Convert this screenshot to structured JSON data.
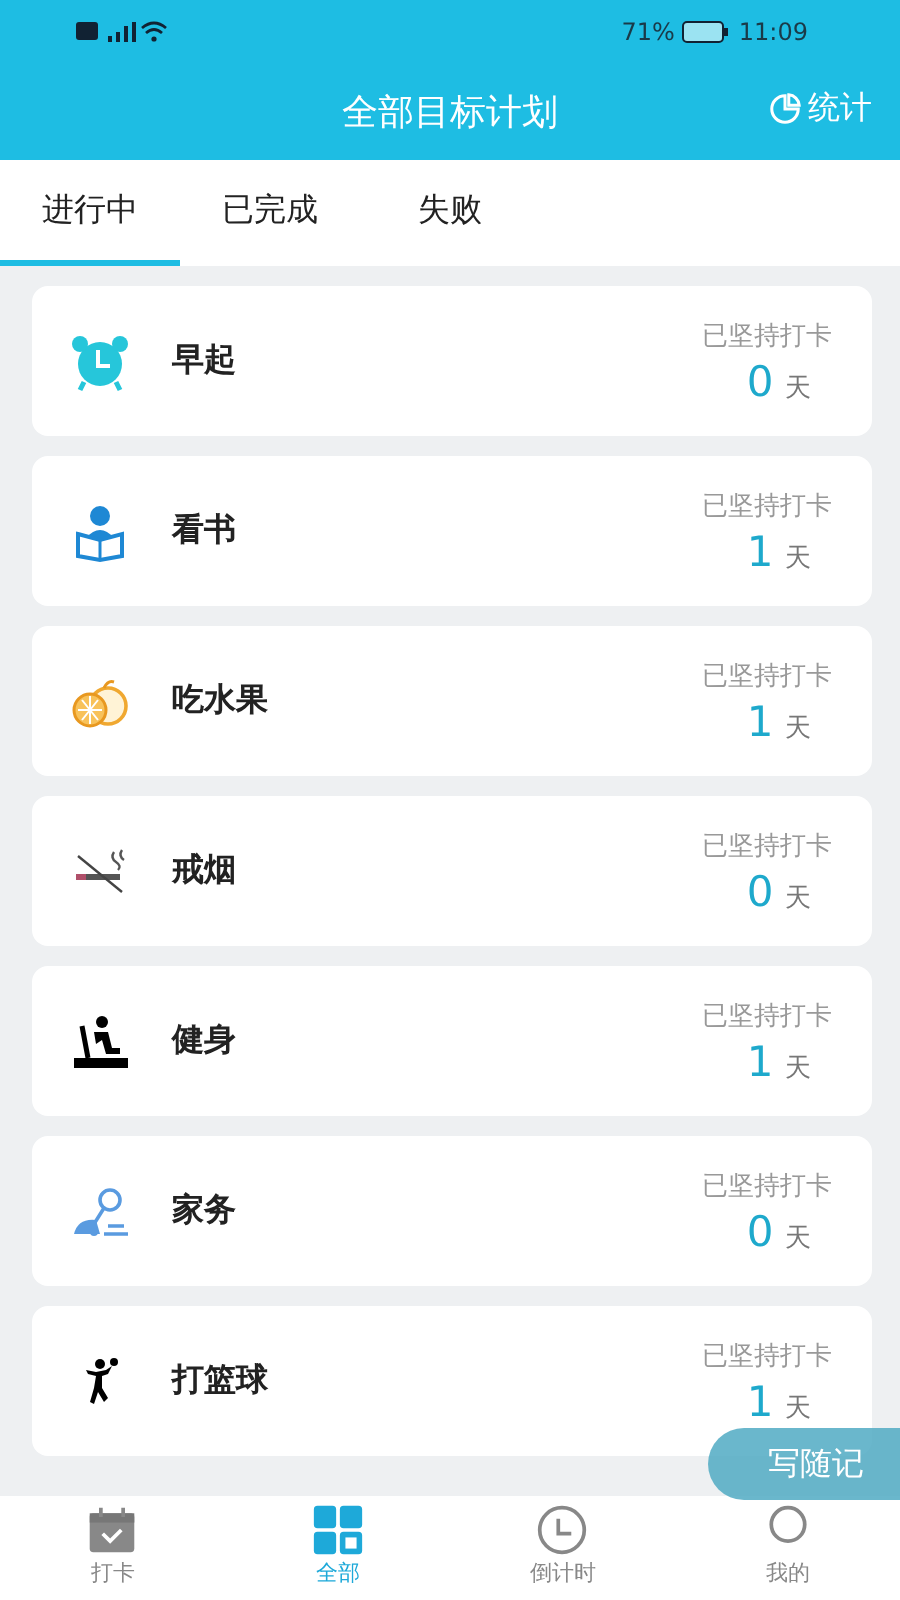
{
  "status_bar": {
    "battery": "71%",
    "time": "11:09"
  },
  "header": {
    "title": "全部目标计划",
    "action": "统计"
  },
  "tabs": [
    {
      "label": "进行中",
      "selected": true
    },
    {
      "label": "已完成",
      "selected": false
    },
    {
      "label": "失败",
      "selected": false
    }
  ],
  "goals": [
    {
      "kind": "alarm",
      "name": "早起",
      "caption": "已坚持打卡",
      "days": "0",
      "unit": "天"
    },
    {
      "kind": "reading",
      "name": "看书",
      "caption": "已坚持打卡",
      "days": "1",
      "unit": "天"
    },
    {
      "kind": "fruit",
      "name": "吃水果",
      "caption": "已坚持打卡",
      "days": "1",
      "unit": "天"
    },
    {
      "kind": "smoking",
      "name": "戒烟",
      "caption": "已坚持打卡",
      "days": "0",
      "unit": "天"
    },
    {
      "kind": "fitness",
      "name": "健身",
      "caption": "已坚持打卡",
      "days": "1",
      "unit": "天"
    },
    {
      "kind": "chores",
      "name": "家务",
      "caption": "已坚持打卡",
      "days": "0",
      "unit": "天"
    },
    {
      "kind": "basketball",
      "name": "打篮球",
      "caption": "已坚持打卡",
      "days": "1",
      "unit": "天"
    }
  ],
  "float_button": "写随记",
  "bottom_nav": [
    {
      "kind": "calendar",
      "label": "打卡",
      "selected": false
    },
    {
      "kind": "grid",
      "label": "全部",
      "selected": true
    },
    {
      "kind": "clock",
      "label": "倒计时",
      "selected": false
    },
    {
      "kind": "person",
      "label": "我的",
      "selected": false
    }
  ]
}
